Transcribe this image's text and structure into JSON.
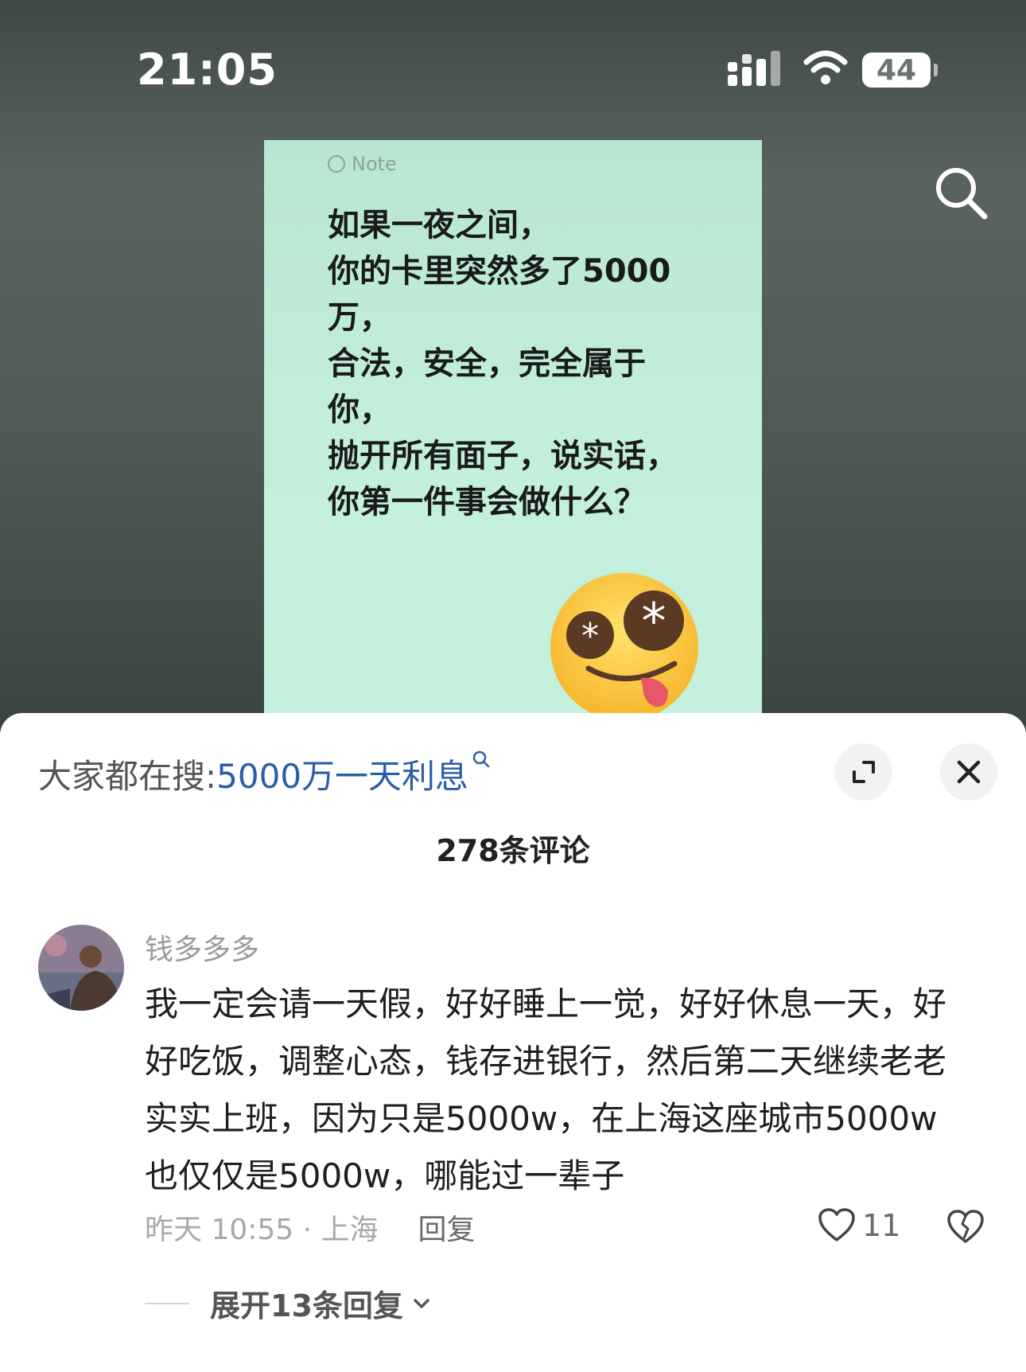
{
  "status_bar": {
    "time": "21:05",
    "battery": "44",
    "signal_icon": "cellular-signal-icon",
    "wifi_icon": "wifi-icon"
  },
  "top_bar": {
    "search_icon": "search-icon"
  },
  "note_card": {
    "header": "Note",
    "lines": [
      "如果一夜之间，",
      "你的卡里突然多了5000",
      "万，",
      "合法，安全，完全属于",
      "你，",
      "抛开所有面子，说实话，",
      "你第一件事会做什么？"
    ],
    "emoji": "money-eyes-emoji"
  },
  "sheet": {
    "search_prefix": "大家都在搜:",
    "search_query": "5000万一天利息",
    "expand_icon": "expand-icon",
    "close_icon": "close-icon",
    "comment_count": "278条评论"
  },
  "comment": {
    "username": "钱多多多",
    "lines": [
      "我一定会请一天假，好好睡上一觉，好好休息一天，好",
      "好吃饭，调整心态，钱存进银行，然后第二天继续老老",
      "实实上班，因为只是5000w，在上海这座城市5000w",
      "也仅仅是5000w，哪能过一辈子"
    ],
    "time_location": "昨天 10:55 · 上海",
    "reply_label": "回复",
    "likes": "11",
    "expand_replies": "展开13条回复"
  },
  "colors": {
    "note_bg": "#c2efda",
    "query_blue": "#2a5ea8",
    "top_bg": "#4f5955"
  }
}
